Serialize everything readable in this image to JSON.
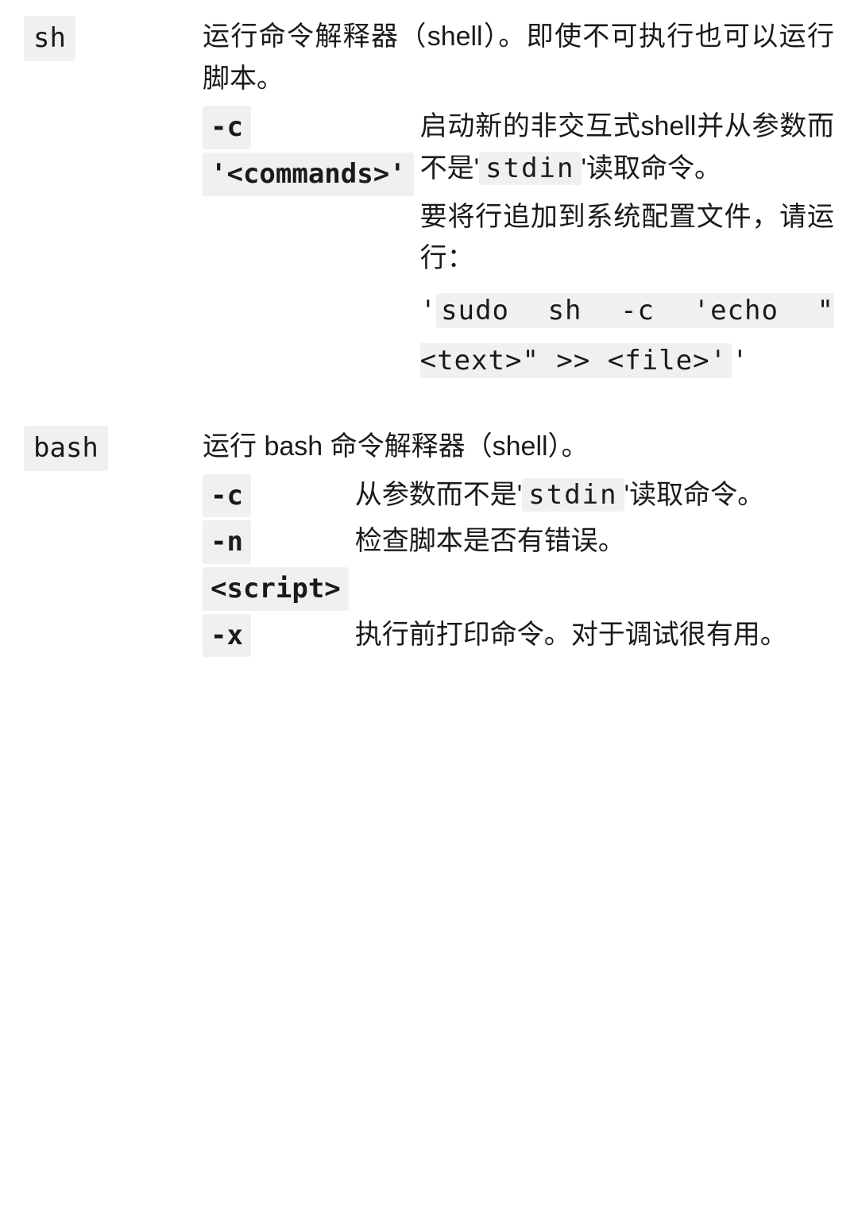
{
  "commands": [
    {
      "name": "sh",
      "desc": "运行命令解释器（shell）。即使不可执行也可以运行脚本。",
      "options": [
        {
          "flags": [
            "-c",
            "'<commands>'"
          ],
          "desc_parts": {
            "p1a": "启动新的非交互式shell并从参数而不是'",
            "code1": "stdin",
            "p1b": "'读取命令。",
            "p2": "要将行追加到系统配置文件，请运行：",
            "q1": "'",
            "cmd_block": "sudo sh -c 'echo \"<text>\" >> <file>'",
            "q2": "'"
          }
        }
      ]
    },
    {
      "name": "bash",
      "desc": "运行 bash 命令解释器（shell）。",
      "options": [
        {
          "flags": [
            "-c"
          ],
          "desc_parts": {
            "p1a": "从参数而不是'",
            "code1": "stdin",
            "p1b": "'读取命令。"
          }
        },
        {
          "flags": [
            "-n",
            "<script>"
          ],
          "desc_simple": "检查脚本是否有错误。"
        },
        {
          "flags": [
            "-x"
          ],
          "desc_simple": "执行前打印命令。对于调试很有用。"
        }
      ]
    }
  ]
}
